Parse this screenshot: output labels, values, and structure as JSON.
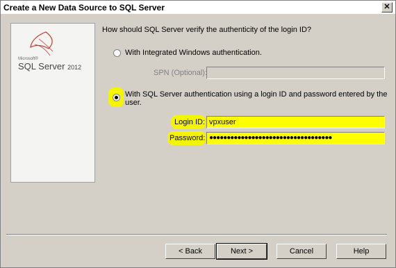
{
  "window": {
    "title": "Create a New Data Source to SQL Server",
    "close_label": "✕"
  },
  "logo": {
    "maker": "Microsoft®",
    "product": "SQL Server",
    "year": "2012"
  },
  "question": "How should SQL Server verify the authenticity of the login ID?",
  "options": {
    "windows_auth": "With Integrated Windows authentication.",
    "spn_label": "SPN (Optional):",
    "spn_value": "",
    "sql_auth_line1": "With SQL Server authentication using a login ID and password entered by the",
    "sql_auth_line2": "user."
  },
  "login": {
    "label": "Login ID:",
    "value": "vpxuser"
  },
  "password": {
    "label": "Password:",
    "value": "●●●●●●●●●●●●●●●●●●●●●●●●●●●●●●●●●●●"
  },
  "buttons": {
    "back": "< Back",
    "next": "Next >",
    "cancel": "Cancel",
    "help": "Help"
  }
}
